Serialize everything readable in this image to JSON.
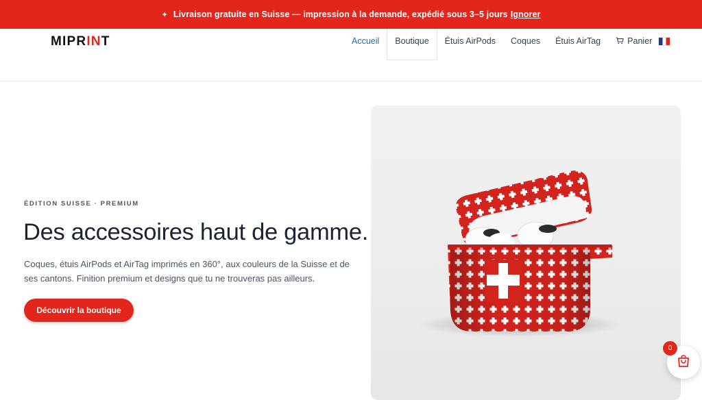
{
  "announcement": {
    "icon": "sparkle-icon",
    "text": "Livraison gratuite en Suisse — impression à la demande, expédié sous 3–5 jours",
    "dismiss_label": "Ignorer"
  },
  "brand": {
    "logo_prefix": "MIPR",
    "logo_accent": "IN",
    "logo_suffix": "T",
    "accent_color": "#e3261c"
  },
  "nav": {
    "items": [
      {
        "label": "Accueil"
      },
      {
        "label": "Boutique"
      },
      {
        "label": "Étuis AirPods"
      },
      {
        "label": "Coques"
      },
      {
        "label": "Étuis AirTag"
      },
      {
        "label": "Panier",
        "icon": "cart-icon"
      }
    ],
    "language_icon": "french-flag-icon",
    "active_color": "#1f6fb2"
  },
  "hero": {
    "eyebrow": "ÉDITION SUISSE · PREMIUM",
    "title": "Des accessoires haut de gamme.",
    "description": "Coques, étuis AirPods et AirTag imprimés en 360°, aux couleurs de la Suisse et de ses cantons. Finition premium et designs que tu ne trouveras pas ailleurs.",
    "cta_label": "Découvrir la boutique"
  },
  "floating_cart": {
    "icon": "shopping-bag-icon",
    "count": "0"
  }
}
